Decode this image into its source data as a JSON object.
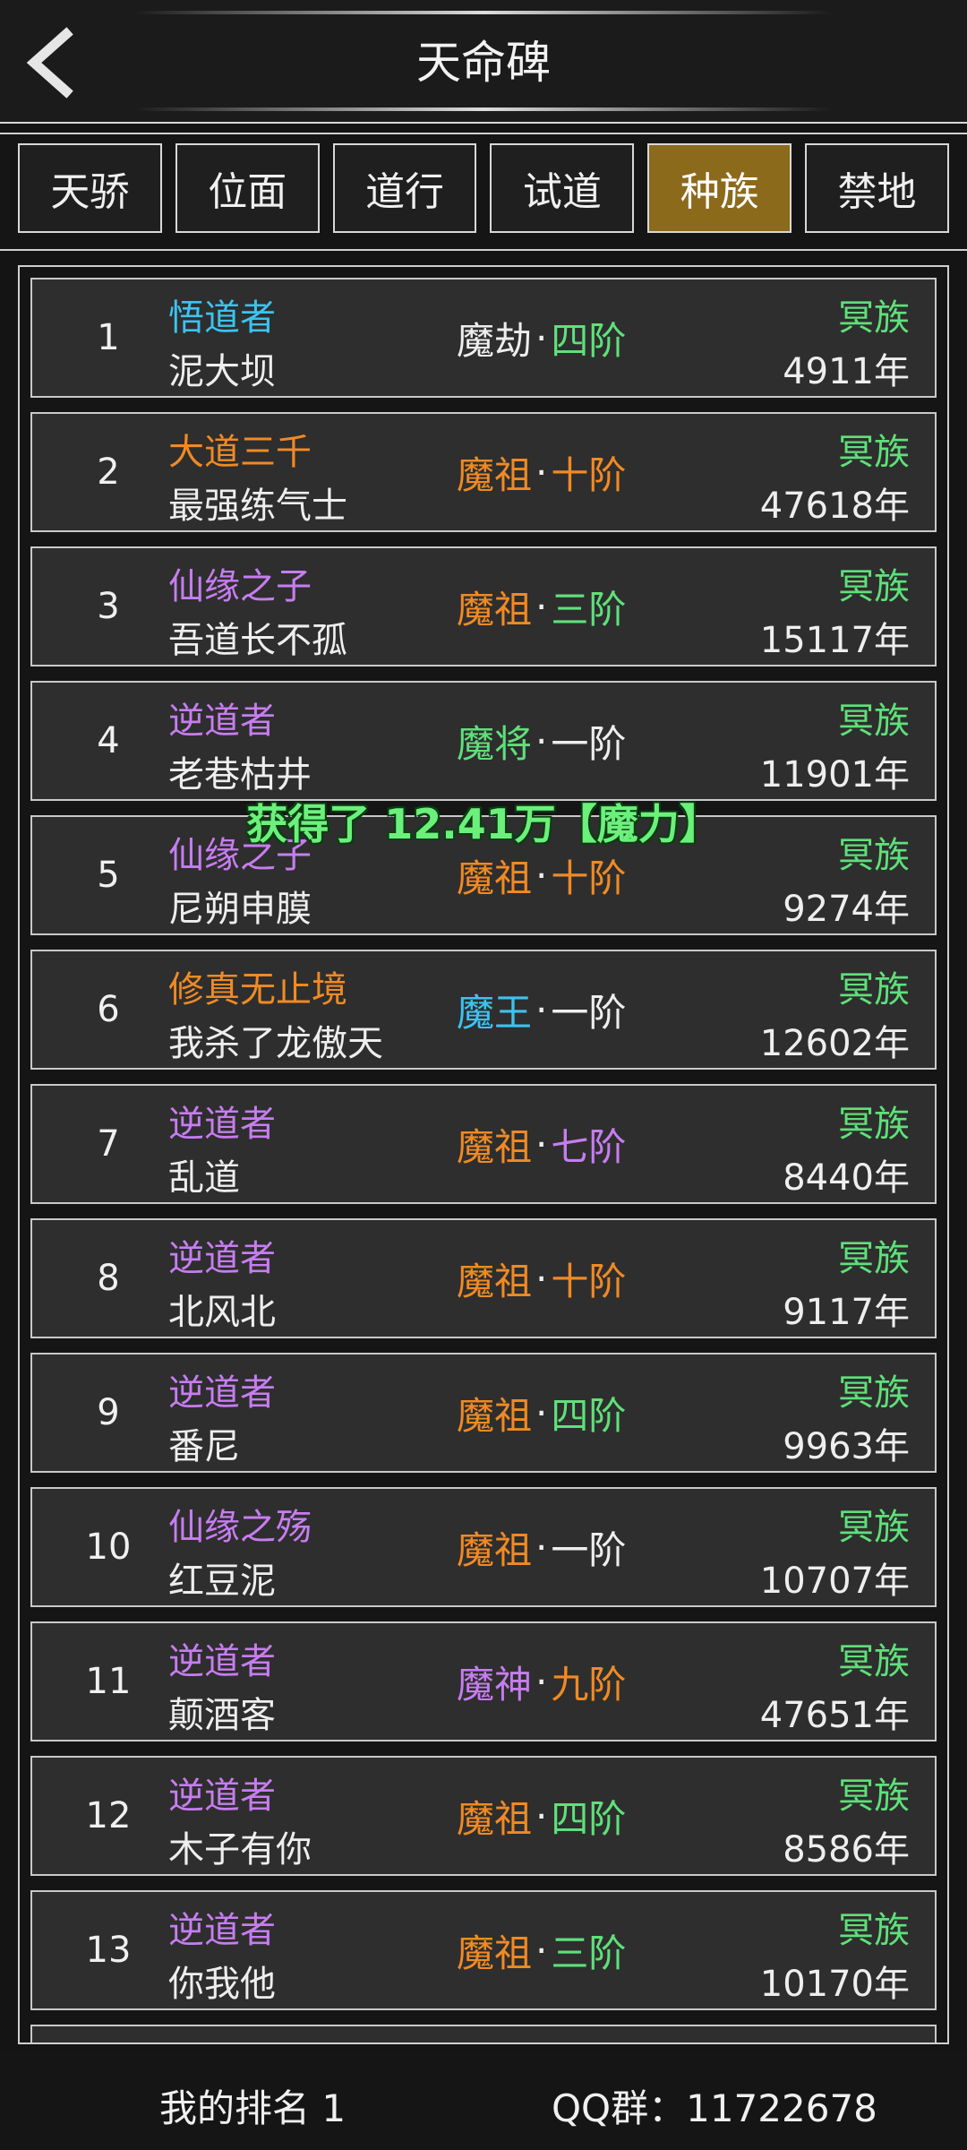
{
  "header": {
    "title": "天命碑",
    "back_icon": "chevron-left-icon"
  },
  "tabs": [
    {
      "label": "天骄",
      "active": false
    },
    {
      "label": "位面",
      "active": false
    },
    {
      "label": "道行",
      "active": false
    },
    {
      "label": "试道",
      "active": false
    },
    {
      "label": "种族",
      "active": true
    },
    {
      "label": "禁地",
      "active": false
    }
  ],
  "rows": [
    {
      "rank": "1",
      "tag": "悟道者",
      "tag_color": "#3cc3f0",
      "name": "泥大坝",
      "realm_a": "魔劫",
      "realm_a_color": "#eeeeee",
      "realm_b": "四阶",
      "realm_b_color": "#5fe07a",
      "race": "冥族",
      "years": "4911年"
    },
    {
      "rank": "2",
      "tag": "大道三千",
      "tag_color": "#f08a24",
      "name": "最强练气士",
      "realm_a": "魔祖",
      "realm_a_color": "#f08a24",
      "realm_b": "十阶",
      "realm_b_color": "#f08a24",
      "race": "冥族",
      "years": "47618年"
    },
    {
      "rank": "3",
      "tag": "仙缘之子",
      "tag_color": "#c77df0",
      "name": "吾道长不孤",
      "realm_a": "魔祖",
      "realm_a_color": "#f08a24",
      "realm_b": "三阶",
      "realm_b_color": "#5fe07a",
      "race": "冥族",
      "years": "15117年"
    },
    {
      "rank": "4",
      "tag": "逆道者",
      "tag_color": "#c77df0",
      "name": "老巷枯井",
      "realm_a": "魔将",
      "realm_a_color": "#5fe07a",
      "realm_b": "一阶",
      "realm_b_color": "#eeeeee",
      "race": "冥族",
      "years": "11901年"
    },
    {
      "rank": "5",
      "tag": "仙缘之子",
      "tag_color": "#c77df0",
      "name": "尼朔申膜",
      "realm_a": "魔祖",
      "realm_a_color": "#f08a24",
      "realm_b": "十阶",
      "realm_b_color": "#f08a24",
      "race": "冥族",
      "years": "9274年"
    },
    {
      "rank": "6",
      "tag": "修真无止境",
      "tag_color": "#f08a24",
      "name": "我杀了龙傲天",
      "realm_a": "魔王",
      "realm_a_color": "#3cc3f0",
      "realm_b": "一阶",
      "realm_b_color": "#eeeeee",
      "race": "冥族",
      "years": "12602年"
    },
    {
      "rank": "7",
      "tag": "逆道者",
      "tag_color": "#c77df0",
      "name": "乱道",
      "realm_a": "魔祖",
      "realm_a_color": "#f08a24",
      "realm_b": "七阶",
      "realm_b_color": "#c77df0",
      "race": "冥族",
      "years": "8440年"
    },
    {
      "rank": "8",
      "tag": "逆道者",
      "tag_color": "#c77df0",
      "name": "北风北",
      "realm_a": "魔祖",
      "realm_a_color": "#f08a24",
      "realm_b": "十阶",
      "realm_b_color": "#f08a24",
      "race": "冥族",
      "years": "9117年"
    },
    {
      "rank": "9",
      "tag": "逆道者",
      "tag_color": "#c77df0",
      "name": "番尼",
      "realm_a": "魔祖",
      "realm_a_color": "#f08a24",
      "realm_b": "四阶",
      "realm_b_color": "#5fe07a",
      "race": "冥族",
      "years": "9963年"
    },
    {
      "rank": "10",
      "tag": "仙缘之殇",
      "tag_color": "#c77df0",
      "name": "红豆泥",
      "realm_a": "魔祖",
      "realm_a_color": "#f08a24",
      "realm_b": "一阶",
      "realm_b_color": "#eeeeee",
      "race": "冥族",
      "years": "10707年"
    },
    {
      "rank": "11",
      "tag": "逆道者",
      "tag_color": "#c77df0",
      "name": "颠酒客",
      "realm_a": "魔神",
      "realm_a_color": "#c77df0",
      "realm_b": "九阶",
      "realm_b_color": "#f08a24",
      "race": "冥族",
      "years": "47651年"
    },
    {
      "rank": "12",
      "tag": "逆道者",
      "tag_color": "#c77df0",
      "name": "木子有你",
      "realm_a": "魔祖",
      "realm_a_color": "#f08a24",
      "realm_b": "四阶",
      "realm_b_color": "#5fe07a",
      "race": "冥族",
      "years": "8586年"
    },
    {
      "rank": "13",
      "tag": "逆道者",
      "tag_color": "#c77df0",
      "name": "你我他",
      "realm_a": "魔祖",
      "realm_a_color": "#f08a24",
      "realm_b": "三阶",
      "realm_b_color": "#5fe07a",
      "race": "冥族",
      "years": "10170年"
    }
  ],
  "realm_separator": "·",
  "toast": "获得了 12.41万【魔力】",
  "footer": {
    "my_rank": "我的排名 1",
    "qq": "QQ群：11722678"
  },
  "colors": {
    "accent_tab": "#8c6a1c",
    "green": "#5fe07a",
    "orange": "#f08a24",
    "purple": "#c77df0",
    "cyan": "#3cc3f0"
  }
}
